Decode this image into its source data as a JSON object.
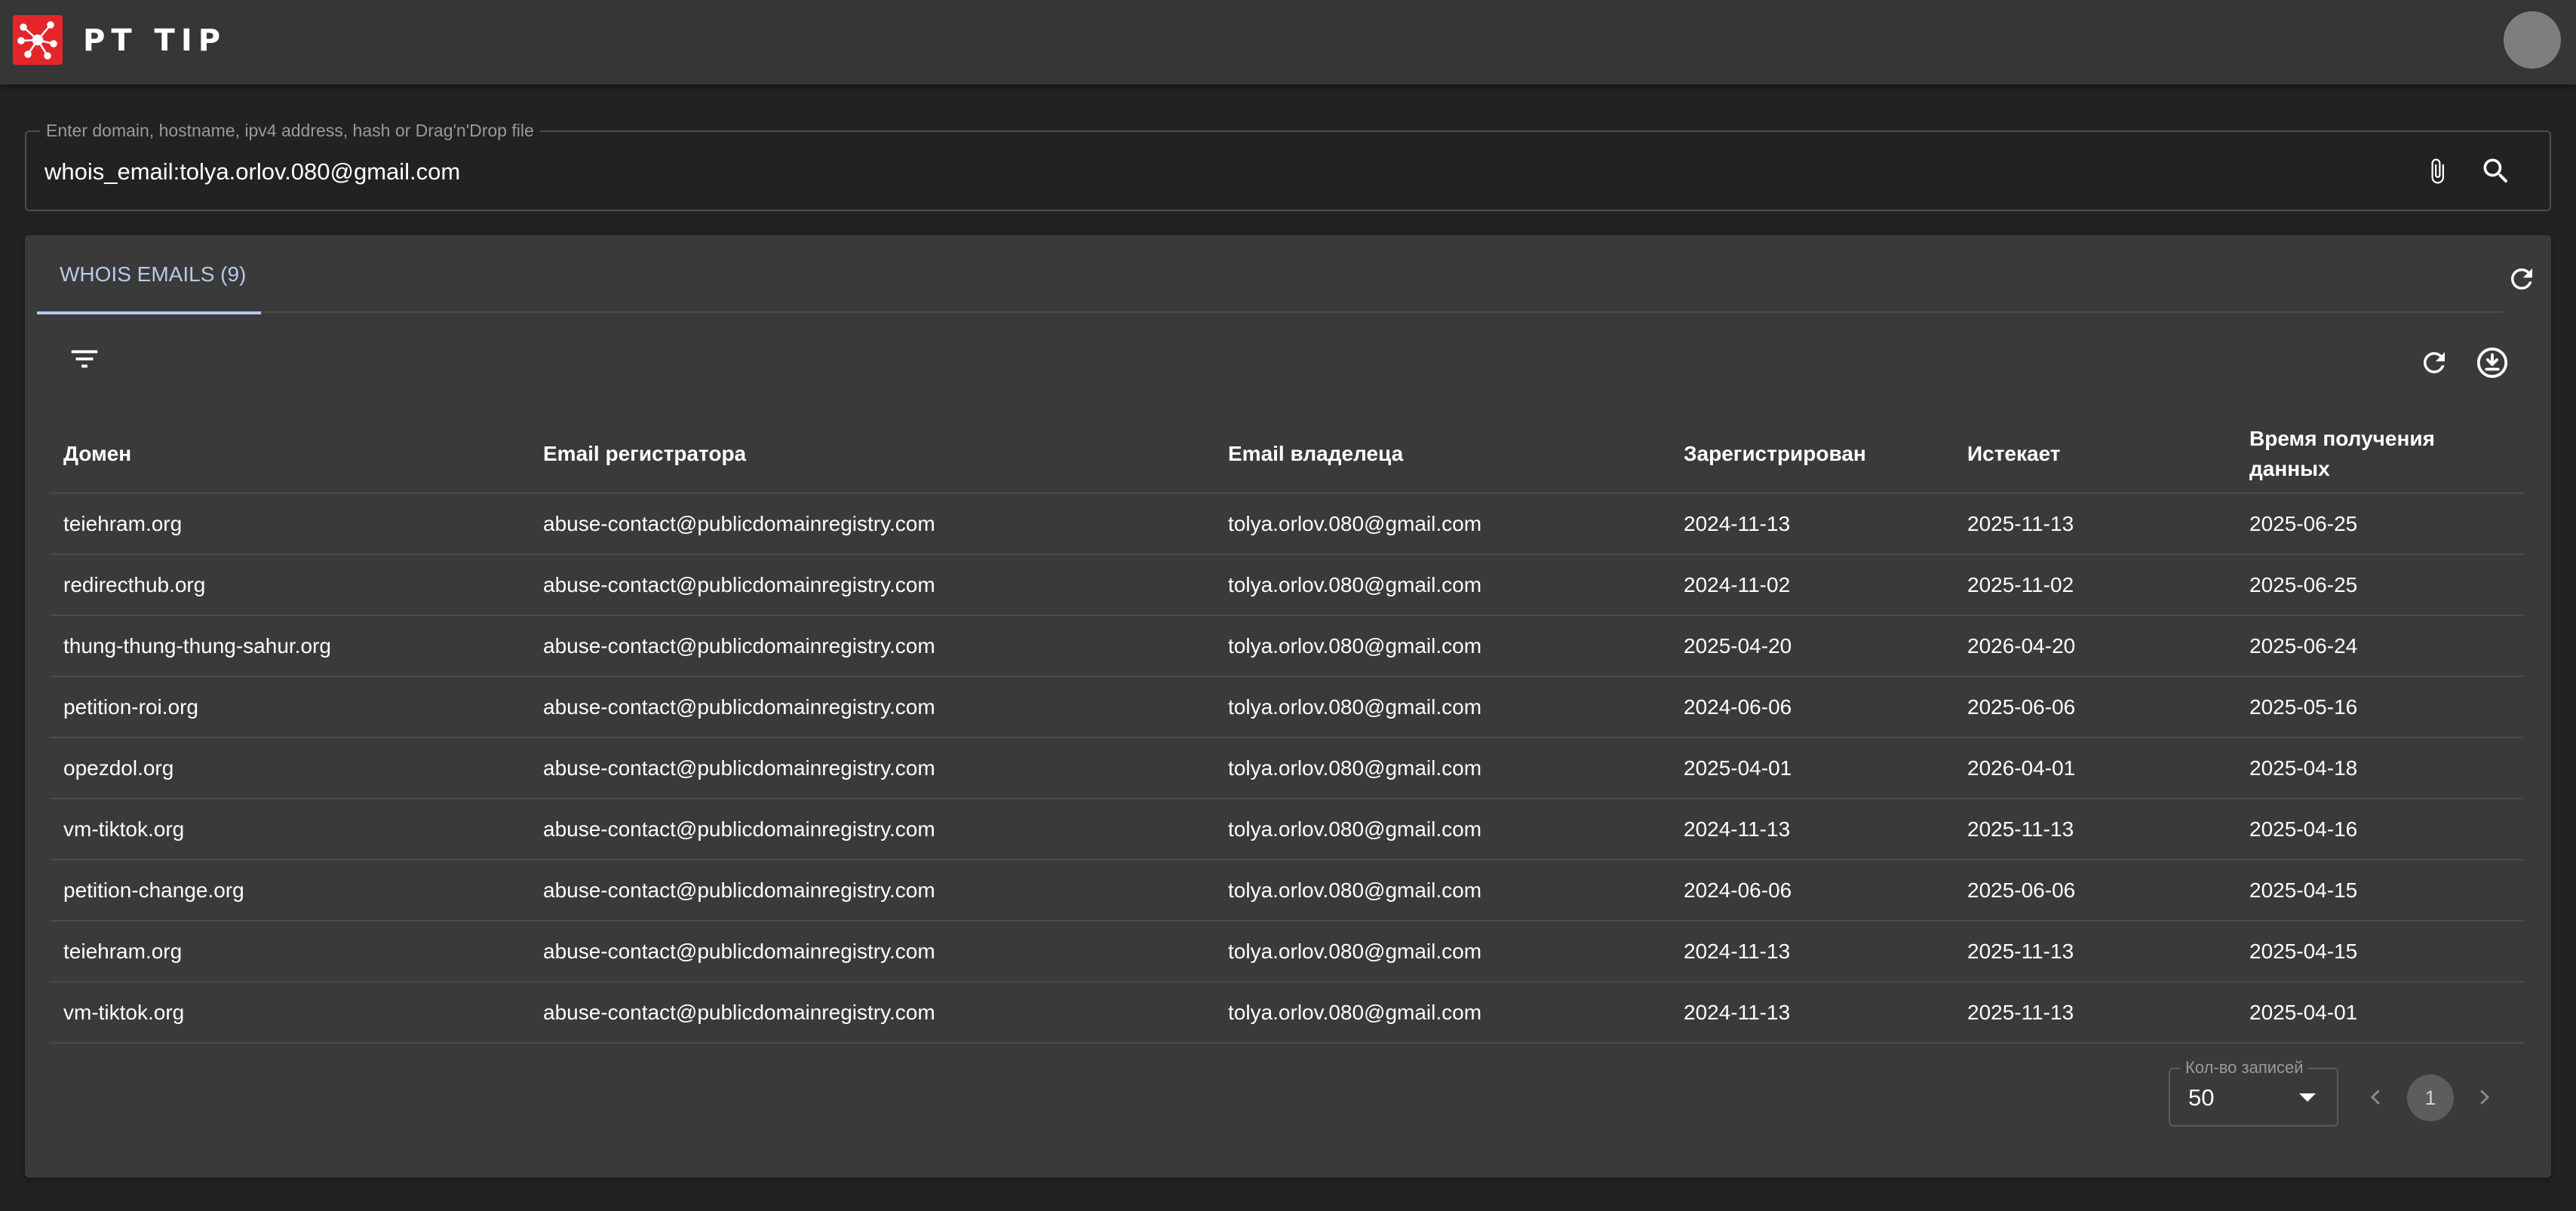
{
  "app": {
    "title": "PT TIP",
    "logo_icon": "network-nodes-icon",
    "brand_color": "#e3262c"
  },
  "search": {
    "placeholder": "Enter domain, hostname, ipv4 address, hash or Drag'n'Drop file",
    "value": "whois_email:tolya.orlov.080@gmail.com",
    "attach_icon": "paperclip-icon",
    "search_icon": "search-icon"
  },
  "tabs": [
    {
      "label": "WHOIS EMAILS (9)",
      "active": true
    }
  ],
  "table": {
    "columns": [
      "Домен",
      "Email регистратора",
      "Email владелеца",
      "Зарегистрирован",
      "Истекает",
      "Время получения данных"
    ],
    "rows": [
      [
        "teiehram.org",
        "abuse-contact@publicdomainregistry.com",
        "tolya.orlov.080@gmail.com",
        "2024-11-13",
        "2025-11-13",
        "2025-06-25"
      ],
      [
        "redirecthub.org",
        "abuse-contact@publicdomainregistry.com",
        "tolya.orlov.080@gmail.com",
        "2024-11-02",
        "2025-11-02",
        "2025-06-25"
      ],
      [
        "thung-thung-thung-sahur.org",
        "abuse-contact@publicdomainregistry.com",
        "tolya.orlov.080@gmail.com",
        "2025-04-20",
        "2026-04-20",
        "2025-06-24"
      ],
      [
        "petition-roi.org",
        "abuse-contact@publicdomainregistry.com",
        "tolya.orlov.080@gmail.com",
        "2024-06-06",
        "2025-06-06",
        "2025-05-16"
      ],
      [
        "opezdol.org",
        "abuse-contact@publicdomainregistry.com",
        "tolya.orlov.080@gmail.com",
        "2025-04-01",
        "2026-04-01",
        "2025-04-18"
      ],
      [
        "vm-tiktok.org",
        "abuse-contact@publicdomainregistry.com",
        "tolya.orlov.080@gmail.com",
        "2024-11-13",
        "2025-11-13",
        "2025-04-16"
      ],
      [
        "petition-change.org",
        "abuse-contact@publicdomainregistry.com",
        "tolya.orlov.080@gmail.com",
        "2024-06-06",
        "2025-06-06",
        "2025-04-15"
      ],
      [
        "teiehram.org",
        "abuse-contact@publicdomainregistry.com",
        "tolya.orlov.080@gmail.com",
        "2024-11-13",
        "2025-11-13",
        "2025-04-15"
      ],
      [
        "vm-tiktok.org",
        "abuse-contact@publicdomainregistry.com",
        "tolya.orlov.080@gmail.com",
        "2024-11-13",
        "2025-11-13",
        "2025-04-01"
      ]
    ]
  },
  "pagination": {
    "rows_label": "Кол-во записей",
    "rows_value": "50",
    "current_page": "1"
  }
}
